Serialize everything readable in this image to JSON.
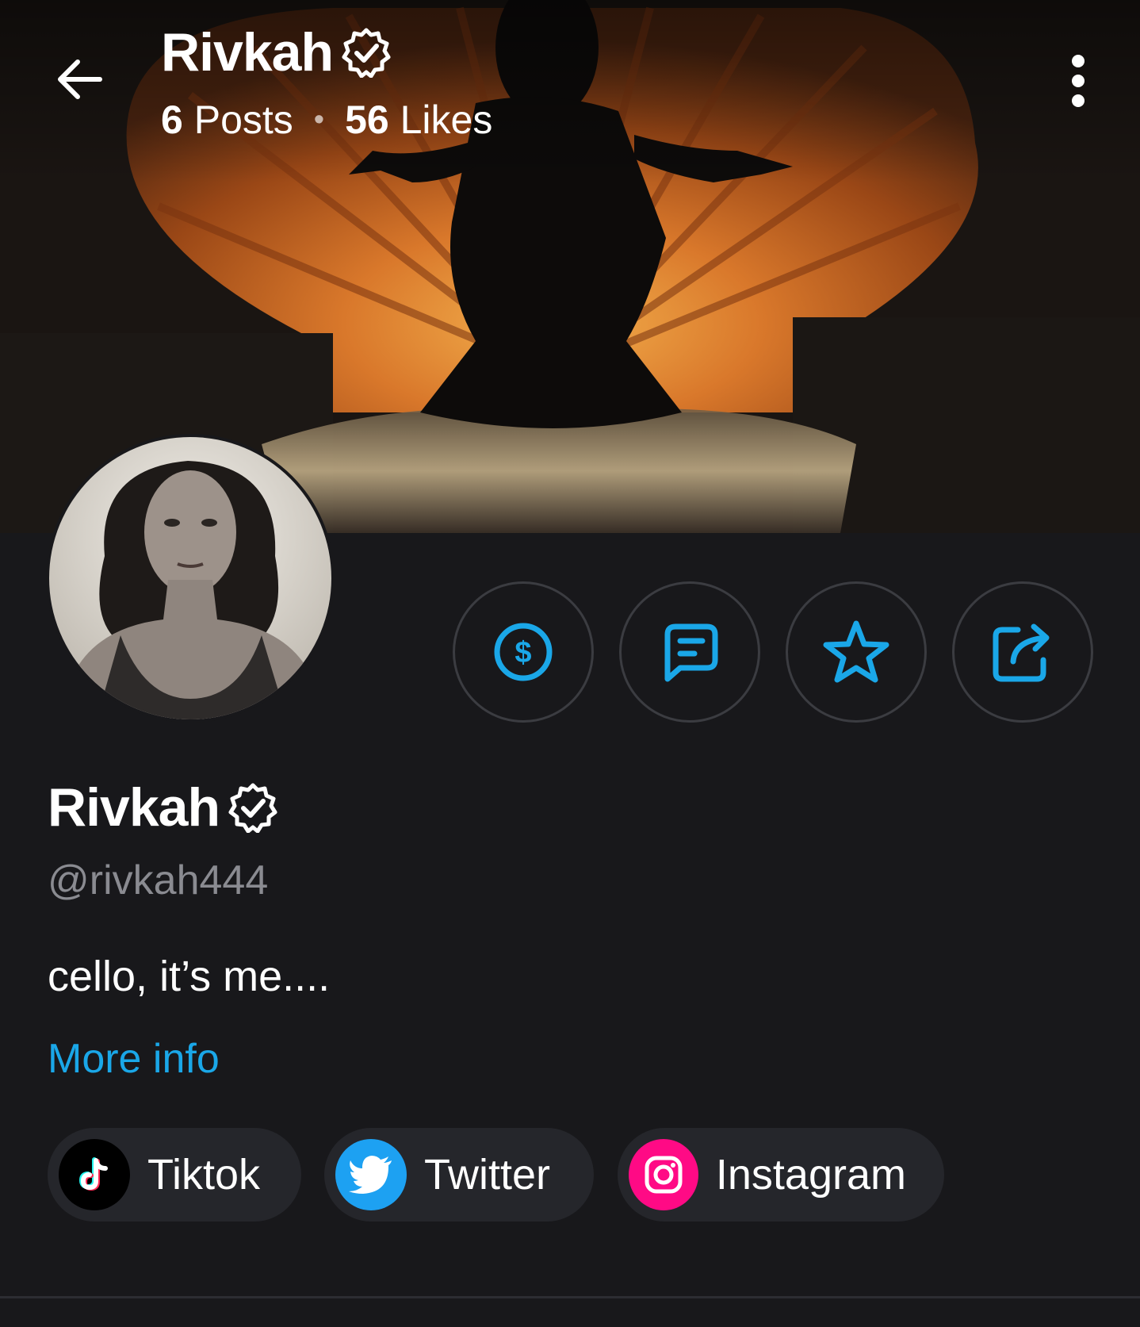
{
  "header": {
    "title": "Rivkah",
    "posts_count": "6",
    "posts_label": "Posts",
    "likes_count": "56",
    "likes_label": "Likes",
    "separator": "•"
  },
  "profile": {
    "name": "Rivkah",
    "handle": "@rivkah444",
    "bio": "cello, it’s me....",
    "more_info": "More info"
  },
  "socials": [
    {
      "label": "Tiktok",
      "icon": "tiktok-icon",
      "color": "#000000"
    },
    {
      "label": "Twitter",
      "icon": "twitter-icon",
      "color": "#1da1f2"
    },
    {
      "label": "Instagram",
      "icon": "instagram-icon",
      "color": "#ff0a85"
    }
  ],
  "actions": [
    {
      "icon": "dollar-icon"
    },
    {
      "icon": "message-icon"
    },
    {
      "icon": "star-icon"
    },
    {
      "icon": "share-icon"
    }
  ],
  "colors": {
    "accent": "#1aa7e8",
    "background": "#18181b",
    "chip_background": "#25262b",
    "muted_text": "#8a8b91"
  }
}
